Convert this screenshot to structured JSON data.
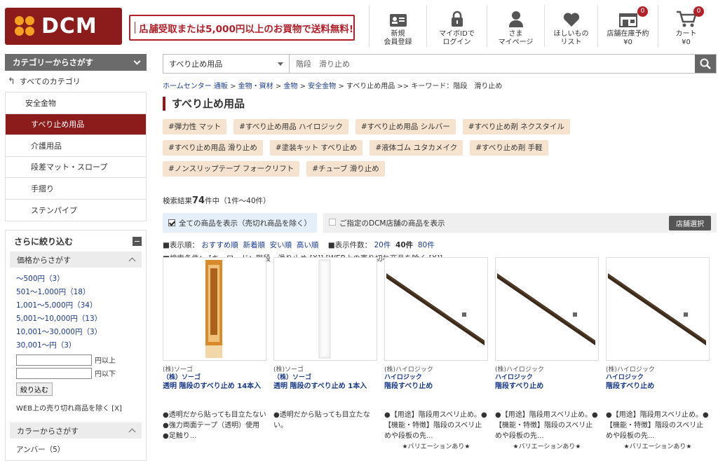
{
  "header": {
    "logo_text": "DCM",
    "banner_text": "店舗受取または5,000円以上のお買物で送料無料!",
    "nav": [
      {
        "name": "register",
        "line1": "新規",
        "line2": "会員登録",
        "icon": "member-card-icon"
      },
      {
        "name": "login",
        "line1": "マイボIDで",
        "line2": "ログイン",
        "icon": "lock-icon"
      },
      {
        "name": "mypage",
        "line1": "さま",
        "line2": "マイページ",
        "icon": "person-icon"
      },
      {
        "name": "wishlist",
        "line1": "ほしいもの",
        "line2": "リスト",
        "icon": "heart-icon"
      },
      {
        "name": "store-reserve",
        "line1": "店舗在庫予約",
        "line2": "¥0",
        "icon": "store-icon",
        "badge": "0"
      },
      {
        "name": "cart",
        "line1": "カート",
        "line2": "¥0",
        "icon": "cart-icon",
        "badge": "0"
      }
    ]
  },
  "sidebar": {
    "category_title": "カテゴリーからさがす",
    "all_categories": "すべてのカテゴリ",
    "categories": [
      {
        "label": "安全金物",
        "active": false
      },
      {
        "label": "すべり止め用品",
        "active": true
      },
      {
        "label": "介護用品",
        "active": false
      },
      {
        "label": "段差マット・スロープ",
        "active": false
      },
      {
        "label": "手摺り",
        "active": false
      },
      {
        "label": "ステンパイプ",
        "active": false
      }
    ],
    "refine_title": "さらに絞り込む",
    "price_title": "価格からさがす",
    "prices": [
      "〜500円（3）",
      "501〜1,000円（18）",
      "1,001〜5,000円（34）",
      "5,001〜10,000円（13）",
      "10,001〜30,000円（3）",
      "30,001〜円（3）"
    ],
    "above_label": "円以上",
    "below_label": "円以下",
    "filter_button": "絞り込む",
    "exclude_text": "WEB上の売り切れ商品を除く [X]",
    "color_title": "カラーからさがす",
    "color_first": "アンバー（5）"
  },
  "main": {
    "search_category": "すべり止め用品",
    "search_value": "階段　滑り止め",
    "breadcrumb": [
      "ホームセンター 通販",
      "金物・資材",
      "金物",
      "安全金物",
      "すべり止め用品",
      ">> キーワード：階段　滑り止め"
    ],
    "page_title": "すべり止め用品",
    "tags": [
      "#弾力性 マット",
      "#すべり止め用品 ハイロジック",
      "#すべり止め用品 シルバー",
      "#すべり止め剤 ネクスタイル",
      "#すべり止め用品 滑り止め",
      "#塗装キット すべり止め",
      "#液体ゴム ユタカメイク",
      "#すべり止め剤 手軽",
      "#ノンスリップテープ フォークリフト",
      "#チューブ 滑り止め"
    ],
    "count_prefix": "検索結果",
    "count_value": "74",
    "count_suffix": "件中（1件〜40件）",
    "filter_all": "全ての商品を表示（売切れ商品を除く）",
    "filter_store": "ご指定のDCM店舗の商品を表示",
    "store_button": "店舗選択",
    "sort_label": "■表示順：",
    "sort_options": [
      "おすすめ順",
      "新着順",
      "安い順",
      "高い順"
    ],
    "perpage_label": "■表示件数：",
    "perpage_options": [
      "20件",
      "40件",
      "80件"
    ],
    "perpage_active": "40件",
    "conditions_label": "■検索条件：",
    "conditions_text": "[キーワード：階段　滑り止め [X]] [WEB上の売り切れ商品を除く [X]]"
  },
  "products": [
    {
      "maker": "(株)ソーゴ",
      "brand": "（株）ソーゴ",
      "name": "透明 階段のすべり止め 14本入",
      "desc": "●透明だから貼っても目立たない　●強力両面テープ（透明）使用　●足触り...",
      "variation": ""
    },
    {
      "maker": "(株)ソーゴ",
      "brand": "（株）ソーゴ",
      "name": "透明 階段のすべり止め 1本入",
      "desc": "●透明だから貼っても目立たない。",
      "variation": ""
    },
    {
      "maker": "(株)ハイロジック",
      "brand": "ハイロジック",
      "name": "階段すべり止め",
      "desc": "●【用途】階段用スベリ止め。●【機能・特徴】階段のスベリ止めや段板の先...",
      "variation": "★バリエーションあり★"
    },
    {
      "maker": "(株)ハイロジック",
      "brand": "ハイロジック",
      "name": "階段すべり止め",
      "desc": "●【用途】階段用スベリ止め。●【機能・特徴】階段のスベリ止めや段板の先...",
      "variation": "★バリエーションあり★"
    },
    {
      "maker": "(株)ハイロジック",
      "brand": "ハイロジック",
      "name": "階段すべり止め",
      "desc": "●【用途】階段用スベリ止め。●【機能・特徴】階段のスベリ止めや段板の先...",
      "variation": "★バリエーションあり★"
    }
  ],
  "colors": {
    "brand_red": "#8c1b1b",
    "banner_red": "#b2202a",
    "tag_bg": "#f5e3cf",
    "link": "#1a3a8a"
  }
}
